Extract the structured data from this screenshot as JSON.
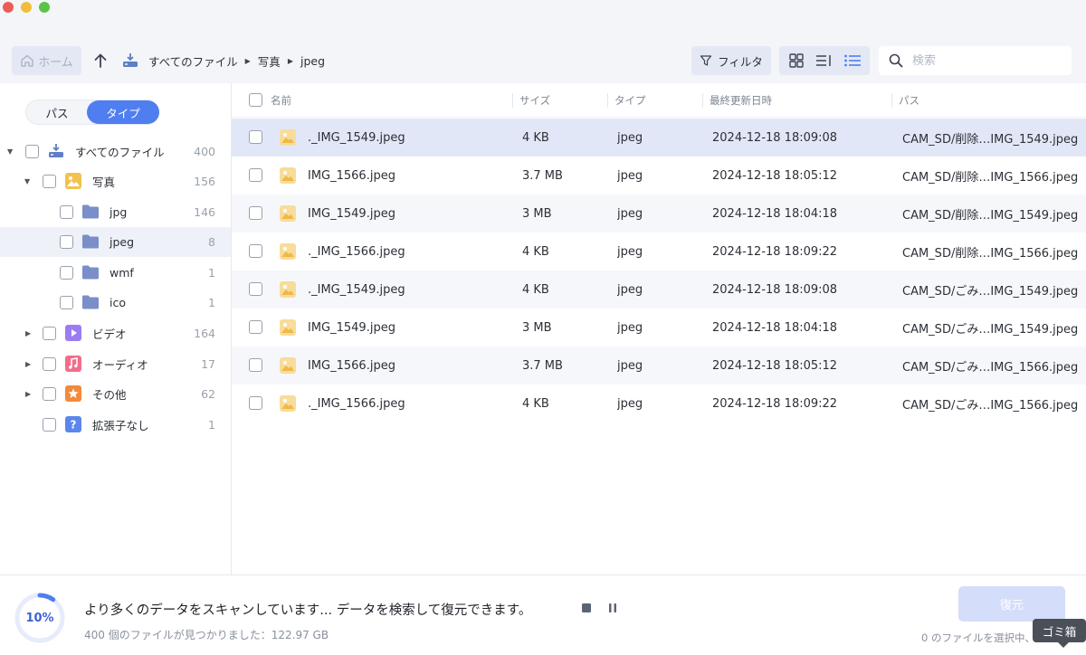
{
  "toolbar": {
    "home_label": "ホーム",
    "breadcrumb": [
      "すべてのファイル",
      "写真",
      "jpeg"
    ],
    "filter_label": "フィルタ",
    "search_placeholder": "検索"
  },
  "sidebar": {
    "tab_path": "パス",
    "tab_type": "タイプ",
    "tree": [
      {
        "label": "すべてのファイル",
        "count": "400",
        "icon": "drive-icon"
      },
      {
        "label": "写真",
        "count": "156",
        "icon": "photo-category-icon"
      },
      {
        "label": "jpg",
        "count": "146",
        "icon": "folder-icon"
      },
      {
        "label": "jpeg",
        "count": "8",
        "icon": "folder-icon"
      },
      {
        "label": "wmf",
        "count": "1",
        "icon": "folder-icon"
      },
      {
        "label": "ico",
        "count": "1",
        "icon": "folder-icon"
      },
      {
        "label": "ビデオ",
        "count": "164",
        "icon": "video-category-icon",
        "color": "#9b7cf2"
      },
      {
        "label": "オーディオ",
        "count": "17",
        "icon": "audio-category-icon",
        "color": "#f36d8a"
      },
      {
        "label": "その他",
        "count": "62",
        "icon": "other-category-icon",
        "color": "#f28a3c"
      },
      {
        "label": "拡張子なし",
        "count": "1",
        "icon": "unknown-category-icon",
        "color": "#5b86ee"
      }
    ]
  },
  "table": {
    "columns": [
      "名前",
      "サイズ",
      "タイプ",
      "最終更新日時",
      "パス"
    ],
    "rows": [
      {
        "name": "._IMG_1549.jpeg",
        "size": "4 KB",
        "type": "jpeg",
        "modified": "2024-12-18 18:09:08",
        "path": "CAM_SD/削除…IMG_1549.jpeg"
      },
      {
        "name": "IMG_1566.jpeg",
        "size": "3.7 MB",
        "type": "jpeg",
        "modified": "2024-12-18 18:05:12",
        "path": "CAM_SD/削除…IMG_1566.jpeg"
      },
      {
        "name": "IMG_1549.jpeg",
        "size": "3 MB",
        "type": "jpeg",
        "modified": "2024-12-18 18:04:18",
        "path": "CAM_SD/削除…IMG_1549.jpeg"
      },
      {
        "name": "._IMG_1566.jpeg",
        "size": "4 KB",
        "type": "jpeg",
        "modified": "2024-12-18 18:09:22",
        "path": "CAM_SD/削除…IMG_1566.jpeg"
      },
      {
        "name": "._IMG_1549.jpeg",
        "size": "4 KB",
        "type": "jpeg",
        "modified": "2024-12-18 18:09:08",
        "path": "CAM_SD/ごみ…IMG_1549.jpeg"
      },
      {
        "name": "IMG_1549.jpeg",
        "size": "3 MB",
        "type": "jpeg",
        "modified": "2024-12-18 18:04:18",
        "path": "CAM_SD/ごみ…IMG_1549.jpeg"
      },
      {
        "name": "IMG_1566.jpeg",
        "size": "3.7 MB",
        "type": "jpeg",
        "modified": "2024-12-18 18:05:12",
        "path": "CAM_SD/ごみ…IMG_1566.jpeg"
      },
      {
        "name": "._IMG_1566.jpeg",
        "size": "4 KB",
        "type": "jpeg",
        "modified": "2024-12-18 18:09:22",
        "path": "CAM_SD/ごみ…IMG_1566.jpeg"
      }
    ]
  },
  "status": {
    "progress_percent": "10%",
    "progress_fraction": 0.1,
    "scan_message": "より多くのデータをスキャンしています... データを検索して復元できます。",
    "found_message": "400 個のファイルが見つかりました：122.97 GB",
    "recover_label": "復元",
    "selected_message": "0 のファイルを選択中、",
    "trash_tooltip": "ゴミ箱"
  },
  "colors": {
    "accent": "#4f7ef0",
    "selected_row": "#e2e7f8",
    "folder": "#7a8fc9",
    "photo_icon": "#f3c14e"
  }
}
